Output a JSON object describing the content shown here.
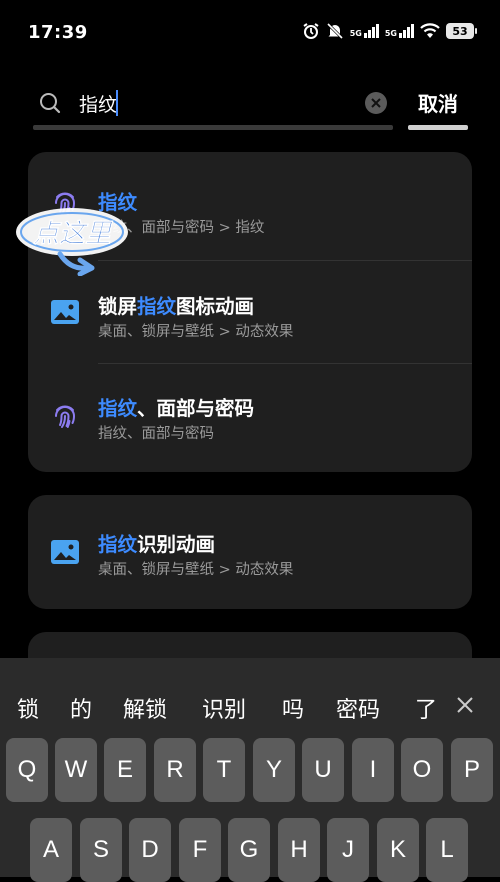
{
  "status_bar": {
    "time": "17:39",
    "battery": "53",
    "net1": "5G",
    "net2": "5G"
  },
  "search": {
    "query": "指纹",
    "cancel_label": "取消"
  },
  "sticker": {
    "text": "点这里"
  },
  "results": [
    {
      "title_hl": "指纹",
      "title_rest": "",
      "subtitle": "指纹、面部与密码 > 指纹",
      "icon": "fingerprint-icon"
    },
    {
      "title_pre": "锁屏",
      "title_hl": "指纹",
      "title_rest": "图标动画",
      "subtitle": "桌面、锁屏与壁纸 > 动态效果",
      "icon": "image-icon"
    },
    {
      "title_hl": "指纹",
      "title_rest": "、面部与密码",
      "subtitle": "指纹、面部与密码",
      "icon": "fingerprint-icon"
    },
    {
      "title_hl": "指纹",
      "title_rest": "识别动画",
      "subtitle": "桌面、锁屏与壁纸 > 动态效果",
      "icon": "image-icon"
    }
  ],
  "keyboard": {
    "candidates": [
      "锁",
      "的",
      "解锁",
      "识别",
      "吗",
      "密码",
      "了"
    ],
    "row1": [
      "Q",
      "W",
      "E",
      "R",
      "T",
      "Y",
      "U",
      "I",
      "O",
      "P"
    ],
    "row2": [
      "A",
      "S",
      "D",
      "F",
      "G",
      "H",
      "J",
      "K",
      "L"
    ]
  },
  "colors": {
    "highlight": "#3d8bff",
    "card": "#1f1f1f",
    "fingerprint": "#8c7cf0",
    "image_icon": "#4aa3f0"
  }
}
